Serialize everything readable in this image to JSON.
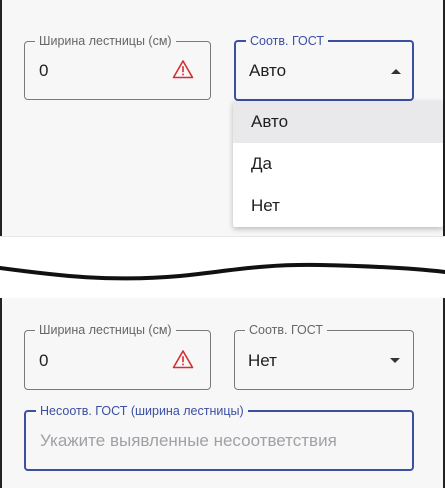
{
  "top": {
    "width_field": {
      "label": "Ширина лестницы (см)",
      "value": "0"
    },
    "gost_field": {
      "label": "Соотв. ГОСТ",
      "value": "Авто"
    },
    "dropdown": {
      "options": [
        "Авто",
        "Да",
        "Нет"
      ],
      "selected": "Авто"
    }
  },
  "bottom": {
    "width_field": {
      "label": "Ширина лестницы (см)",
      "value": "0"
    },
    "gost_field": {
      "label": "Соотв. ГОСТ",
      "value": "Нет"
    },
    "nonconformity_field": {
      "label": "Несоотв. ГОСТ (ширина лестницы)",
      "placeholder": "Укажите выявленные несоответствия"
    }
  },
  "colors": {
    "accent": "#3b4fa3",
    "warning": "#d32f2f",
    "panel_bg": "#f7f7f8"
  },
  "icons": {
    "warning": "warning-triangle-icon",
    "dropdown_open": "arrow-up-icon",
    "dropdown_closed": "arrow-down-icon"
  }
}
